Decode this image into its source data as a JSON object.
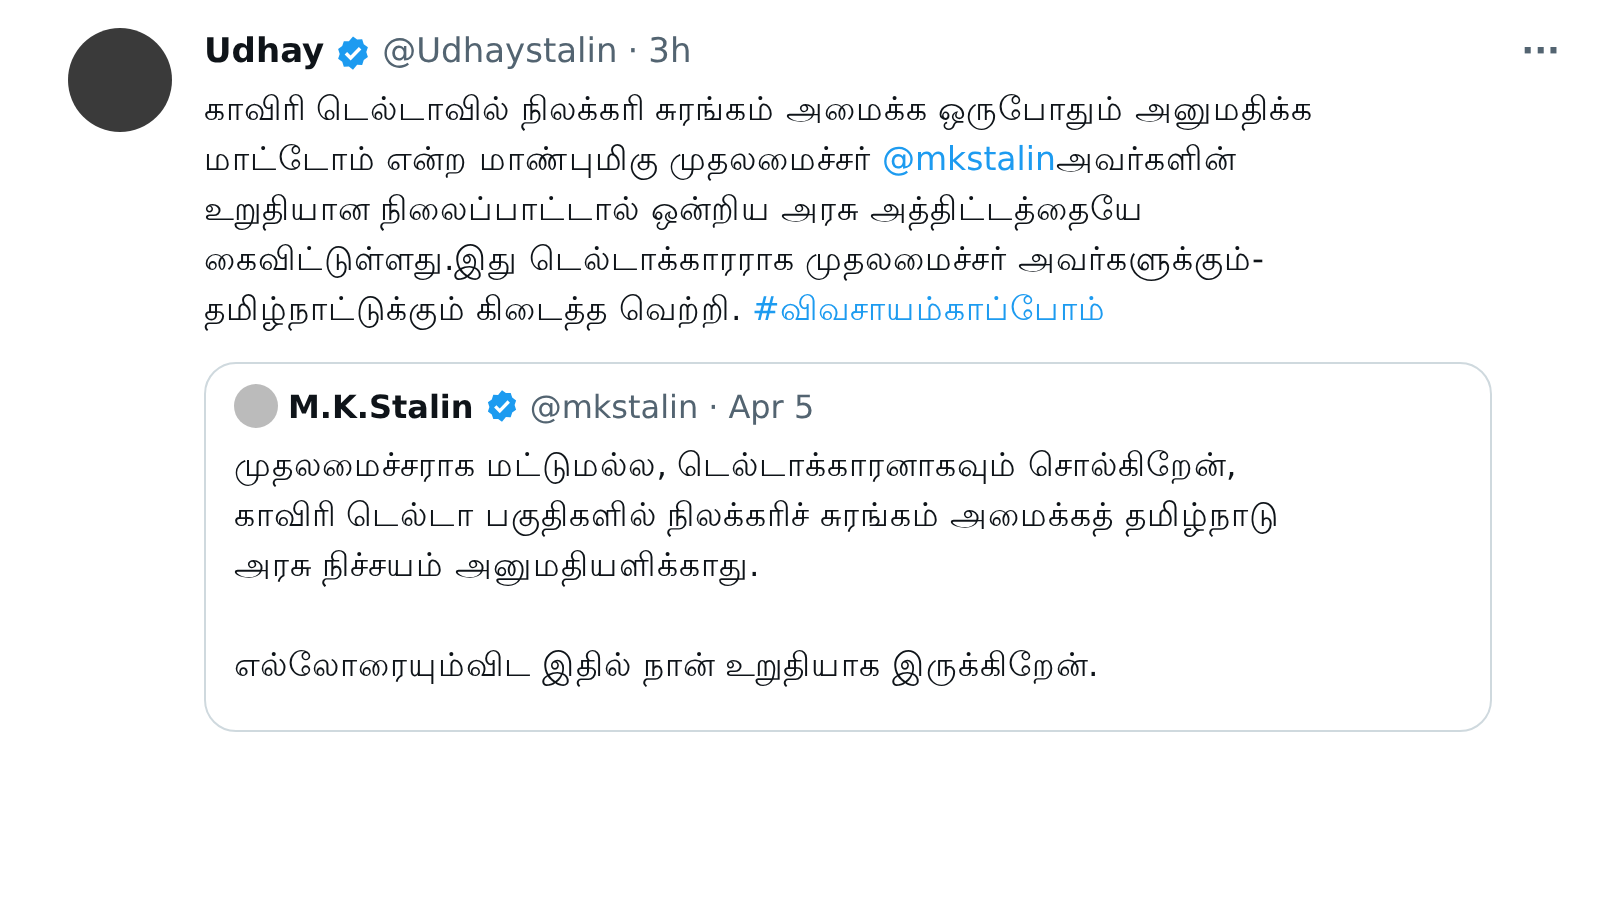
{
  "tweet": {
    "name": "Udhay",
    "verified": true,
    "handle": "@Udhaystalin",
    "time": "3h",
    "separator": "·",
    "more": "···",
    "body": [
      {
        "kind": "text",
        "text": "காவிரி டெல்டாவில் நிலக்கரி சுரங்கம் அமைக்க ஒருபோதும் அனுமதிக்க மாட்டோம் என்ற மாண்புமிகு முதலமைச்சர் "
      },
      {
        "kind": "link",
        "text": "@mkstalin"
      },
      {
        "kind": "text",
        "text": "அவர்களின் உறுதியான நிலைப்பாட்டால் ஒன்றிய அரசு அத்திட்டத்தையே கைவிட்டுள்ளது.இது டெல்டாக்காரராக முதலமைச்சர் அவர்களுக்கும்-தமிழ்நாட்டுக்கும் கிடைத்த வெற்றி. "
      },
      {
        "kind": "link",
        "text": "#விவசாயம்காப்போம்"
      }
    ],
    "quote": {
      "name": "M.K.Stalin",
      "verified": true,
      "handle": "@mkstalin",
      "time": "Apr 5",
      "separator": "·",
      "paragraphs": [
        "முதலமைச்சராக மட்டுமல்ல, டெல்டாக்காரனாகவும் சொல்கிறேன், காவிரி டெல்டா பகுதிகளில் நிலக்கரிச் சுரங்கம் அமைக்கத் தமிழ்நாடு அரசு நிச்சயம் அனுமதியளிக்காது.",
        "எல்லோரையும்விட இதில் நான் உறுதியாக இருக்கிறேன்."
      ]
    }
  }
}
